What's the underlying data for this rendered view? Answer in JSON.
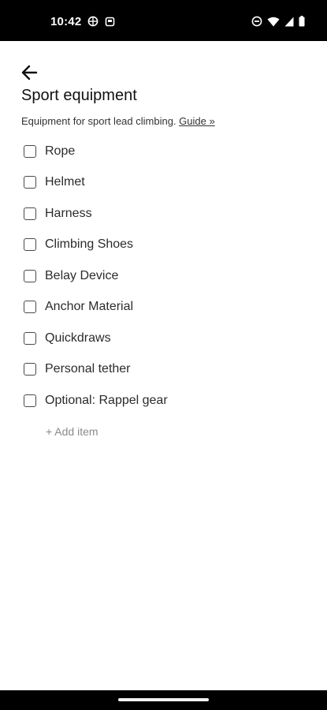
{
  "status_bar": {
    "time": "10:42",
    "left_icons": [
      "vpn-globe-icon",
      "notification-app-icon"
    ],
    "right_icons": [
      "do-not-disturb-icon",
      "wifi-icon",
      "cell-signal-icon",
      "battery-icon"
    ]
  },
  "header": {
    "back_icon": "arrow-left-icon",
    "title": "Sport equipment",
    "description": "Equipment for sport lead climbing.",
    "guide_link": "Guide »"
  },
  "items": [
    {
      "label": "Rope",
      "checked": false
    },
    {
      "label": "Helmet",
      "checked": false
    },
    {
      "label": "Harness",
      "checked": false
    },
    {
      "label": "Climbing Shoes",
      "checked": false
    },
    {
      "label": "Belay Device",
      "checked": false
    },
    {
      "label": "Anchor Material",
      "checked": false
    },
    {
      "label": "Quickdraws",
      "checked": false
    },
    {
      "label": "Personal tether",
      "checked": false
    },
    {
      "label": "Optional: Rappel gear",
      "checked": false
    }
  ],
  "add_item_label": "+ Add item",
  "colors": {
    "bars": "#000000",
    "background": "#ffffff",
    "text": "#1f1f1f",
    "muted": "#8a8a8a"
  }
}
